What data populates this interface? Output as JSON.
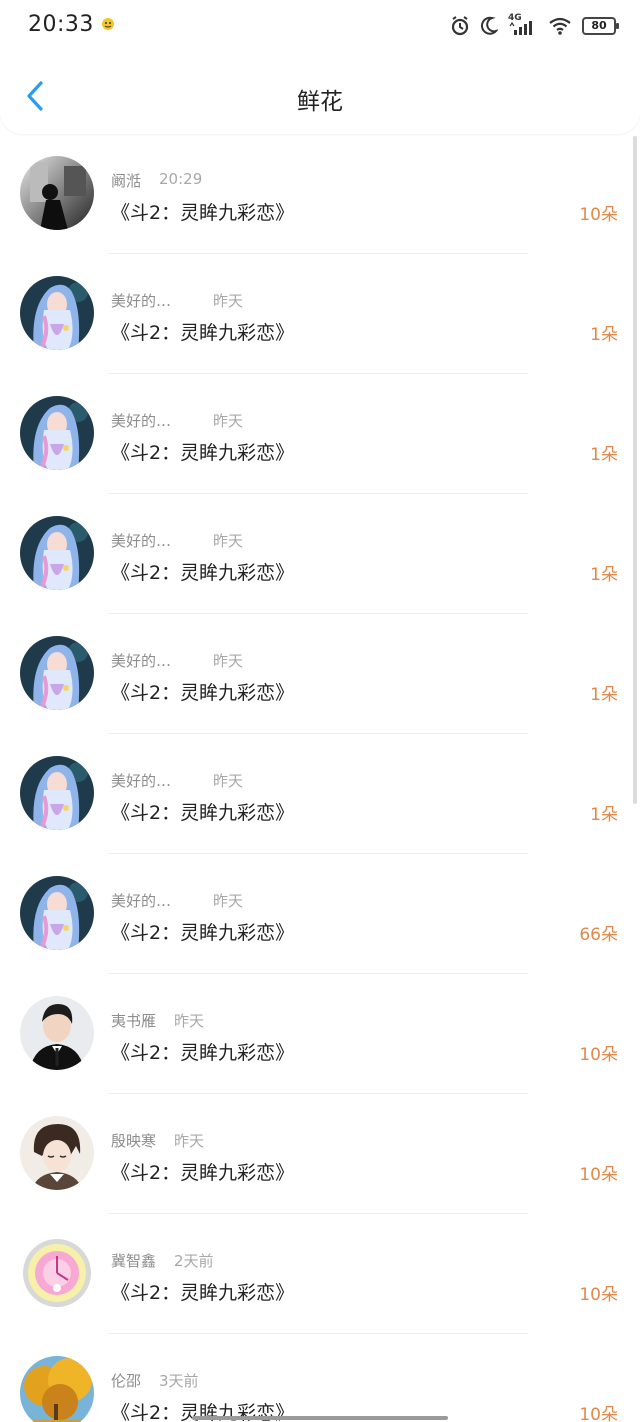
{
  "status": {
    "time": "20:33",
    "network": "4G",
    "battery": "80"
  },
  "header": {
    "title": "鲜花"
  },
  "rows": [
    {
      "name": "阚湉",
      "time": "20:29",
      "book": "《斗2：灵眸九彩恋》",
      "count": "10朵",
      "avatar": "bw"
    },
    {
      "name": "美好的…",
      "time": "昨天",
      "book": "《斗2：灵眸九彩恋》",
      "count": "1朵",
      "avatar": "anime-girl"
    },
    {
      "name": "美好的…",
      "time": "昨天",
      "book": "《斗2：灵眸九彩恋》",
      "count": "1朵",
      "avatar": "anime-girl"
    },
    {
      "name": "美好的…",
      "time": "昨天",
      "book": "《斗2：灵眸九彩恋》",
      "count": "1朵",
      "avatar": "anime-girl"
    },
    {
      "name": "美好的…",
      "time": "昨天",
      "book": "《斗2：灵眸九彩恋》",
      "count": "1朵",
      "avatar": "anime-girl"
    },
    {
      "name": "美好的…",
      "time": "昨天",
      "book": "《斗2：灵眸九彩恋》",
      "count": "1朵",
      "avatar": "anime-girl"
    },
    {
      "name": "美好的…",
      "time": "昨天",
      "book": "《斗2：灵眸九彩恋》",
      "count": "66朵",
      "avatar": "anime-girl"
    },
    {
      "name": "夷书雁",
      "time": "昨天",
      "book": "《斗2：灵眸九彩恋》",
      "count": "10朵",
      "avatar": "boy"
    },
    {
      "name": "殷映寒",
      "time": "昨天",
      "book": "《斗2：灵眸九彩恋》",
      "count": "10朵",
      "avatar": "anime-boy"
    },
    {
      "name": "冀智鑫",
      "time": "2天前",
      "book": "《斗2：灵眸九彩恋》",
      "count": "10朵",
      "avatar": "clock"
    },
    {
      "name": "伦邵",
      "time": "3天前",
      "book": "《斗2：灵眸九彩恋》",
      "count": "10朵",
      "avatar": "autumn"
    }
  ],
  "colors": {
    "accent_blue": "#2a9bf0",
    "count_orange": "#e0894a"
  }
}
